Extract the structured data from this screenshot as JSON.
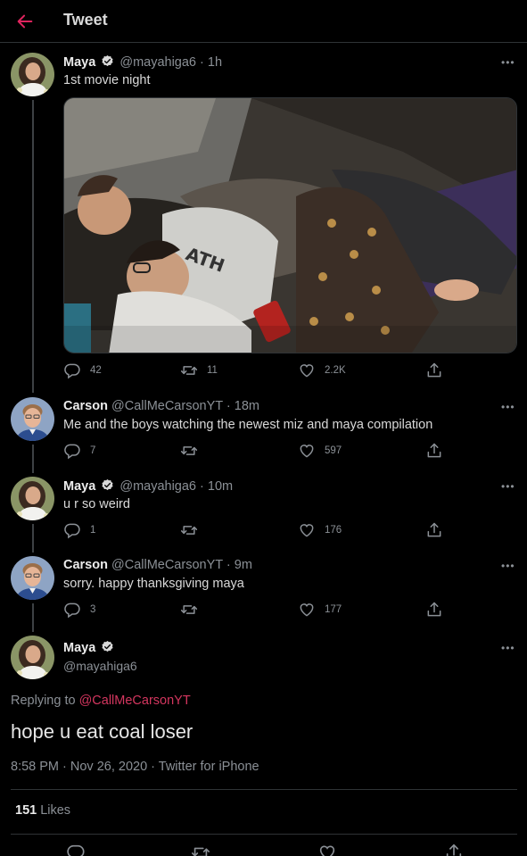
{
  "header": {
    "title": "Tweet"
  },
  "tweets": [
    {
      "name": "Maya",
      "handle": "@mayahiga6",
      "separator": "·",
      "time": "1h",
      "text": "1st movie night",
      "verified": true,
      "replies": "42",
      "retweets": "11",
      "likes": "2.2K"
    },
    {
      "name": "Carson",
      "handle": "@CallMeCarsonYT",
      "separator": "·",
      "time": "18m",
      "text": "Me and the boys watching the newest miz and maya compilation",
      "verified": false,
      "replies": "7",
      "retweets": "",
      "likes": "597"
    },
    {
      "name": "Maya",
      "handle": "@mayahiga6",
      "separator": "·",
      "time": "10m",
      "text": "u r so weird",
      "verified": true,
      "replies": "1",
      "retweets": "",
      "likes": "176"
    },
    {
      "name": "Carson",
      "handle": "@CallMeCarsonYT",
      "separator": "·",
      "time": "9m",
      "text": "sorry. happy thanksgiving maya",
      "verified": false,
      "replies": "3",
      "retweets": "",
      "likes": "177"
    }
  ],
  "main_tweet": {
    "name": "Maya",
    "handle": "@mayahiga6",
    "replying_prefix": "Replying to",
    "replying_to": "@CallMeCarsonYT",
    "text": "hope u eat coal loser",
    "meta": "8:58 PM · Nov 26, 2020 · Twitter for iPhone",
    "likes_count": "151",
    "likes_label": "Likes"
  },
  "more_glyph": "•••",
  "colors": {
    "background": "#000000",
    "accent": "#e0245e",
    "verified": "#d9d9d9",
    "muted": "#8b9096",
    "divider": "#2f3336"
  },
  "icons": [
    "back-arrow-icon",
    "verified-badge-icon",
    "reply-icon",
    "retweet-icon",
    "like-icon",
    "share-icon",
    "more-icon"
  ]
}
